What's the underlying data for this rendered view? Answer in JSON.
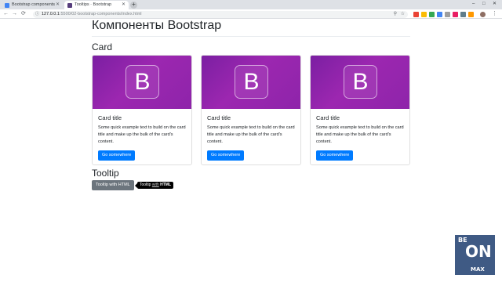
{
  "browser": {
    "tabs": [
      {
        "title": "Bootstrap components",
        "active": false,
        "favicon_color": "#4285f4"
      },
      {
        "title": "Tooltips · Bootstrap",
        "active": true,
        "favicon_color": "#563d7c"
      }
    ],
    "address": {
      "host": "127.0.0.1",
      "path": ":5500/02-bootstrap-components/index.html"
    },
    "new_tab": "+",
    "back": "←",
    "forward": "→",
    "reload": "⟳",
    "window_controls": [
      "–",
      "□",
      "✕"
    ]
  },
  "page": {
    "title": "Компоненты Bootstrap",
    "card_section": "Card",
    "cards": [
      {
        "logo": "B",
        "title": "Card title",
        "text": "Some quick example text to build on the card title and make up the bulk of the card's content.",
        "button": "Go somewhere"
      },
      {
        "logo": "B",
        "title": "Card title",
        "text": "Some quick example text to build on the card title and make up the bulk of the card's content.",
        "button": "Go somewhere"
      },
      {
        "logo": "B",
        "title": "Card title",
        "text": "Some quick example text to build on the card title and make up the bulk of the card's content.",
        "button": "Go somewhere"
      }
    ],
    "tooltip_section": "Tooltip",
    "tooltip_button": "Tooltip with HTML",
    "tooltip": {
      "part1": "Tooltip",
      "part2": "with",
      "part3": "HTML"
    }
  },
  "watermark": {
    "line1": "BE",
    "line2": "ON",
    "line3": "MAX"
  },
  "colors": {
    "primary": "#007bff",
    "secondary": "#6c757d",
    "card_image": "#9c27b0",
    "watermark": "#3f5a84"
  }
}
